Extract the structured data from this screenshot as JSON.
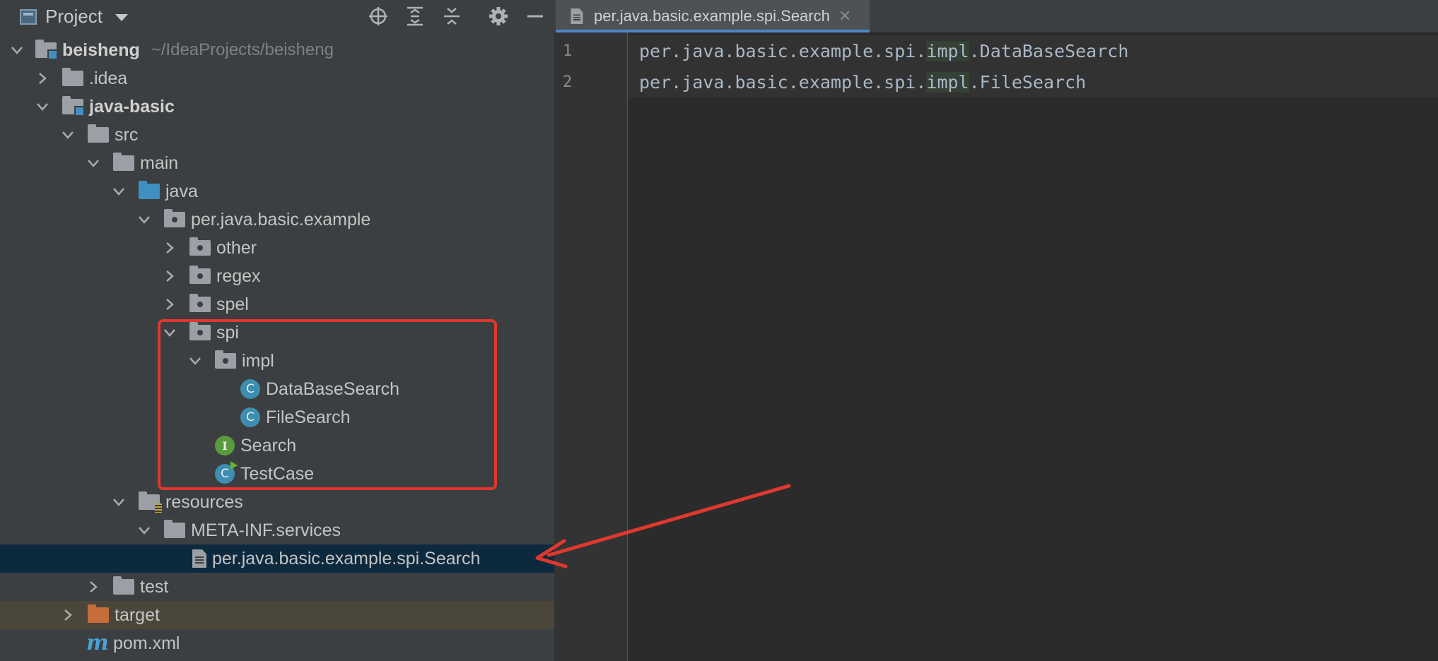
{
  "panel": {
    "title": "Project",
    "icons": [
      "locate-icon",
      "expand-all-icon",
      "collapse-all-icon",
      "gear-icon",
      "hide-icon"
    ]
  },
  "tree": {
    "root": {
      "label": "beisheng",
      "path": "~/IdeaProjects/beisheng"
    },
    "idea": ".idea",
    "java_basic": "java-basic",
    "src": "src",
    "main": "main",
    "java": "java",
    "package": "per.java.basic.example",
    "other": "other",
    "regex": "regex",
    "spel": "spel",
    "spi": "spi",
    "impl": "impl",
    "database_search": "DataBaseSearch",
    "file_search": "FileSearch",
    "search": "Search",
    "test_case": "TestCase",
    "resources": "resources",
    "meta_inf": "META-INF.services",
    "spi_file": "per.java.basic.example.spi.Search",
    "test": "test",
    "target": "target",
    "pom": "pom.xml"
  },
  "icon_letters": {
    "class": "C",
    "interface": "I"
  },
  "editor": {
    "tab_label": "per.java.basic.example.spi.Search",
    "tab_close": "✕",
    "lines": [
      {
        "number": "1",
        "prefix": "per.java.basic.example.spi.",
        "highlight": "impl",
        "suffix": ".DataBaseSearch"
      },
      {
        "number": "2",
        "prefix": "per.java.basic.example.spi.",
        "highlight": "impl",
        "suffix": ".FileSearch"
      }
    ]
  },
  "colors": {
    "annotation": "#e0382e",
    "selection": "#0d293e",
    "excluded": "#4a463a",
    "tab_accent": "#4a88c7"
  }
}
